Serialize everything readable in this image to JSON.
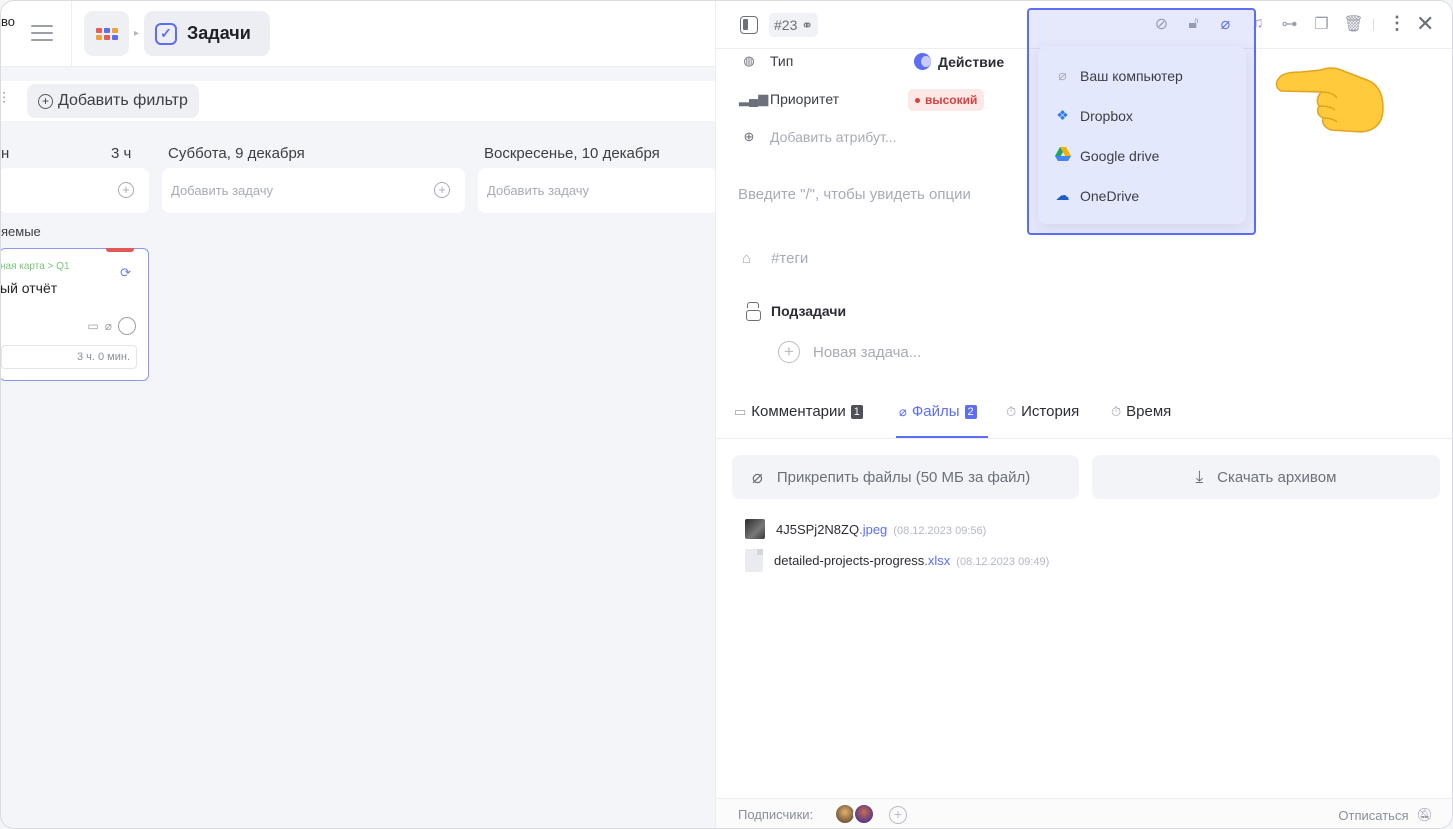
{
  "topbar": {
    "fragment_text": "во",
    "section_title": "Задачи"
  },
  "filter": {
    "add_label": "Добавить фильтр"
  },
  "columns": [
    {
      "title": "н",
      "hours": "3 ч",
      "add_placeholder": ""
    },
    {
      "title": "Суббота, 9 декабря",
      "hours": "",
      "add_placeholder": "Добавить задачу"
    },
    {
      "title": "Воскресенье, 10 декабря",
      "hours": "",
      "add_placeholder": "Добавить задачу"
    }
  ],
  "section_label": "яемые",
  "card": {
    "path": "ная карта > Q1",
    "title": "ый отчёт",
    "time": "3 ч. 0 мин."
  },
  "task": {
    "id": "#23",
    "attributes": {
      "type_label": "Тип",
      "type_value": "Действие",
      "priority_label": "Приоритет",
      "priority_value": "высокий",
      "add_attribute": "Добавить атрибут..."
    },
    "editor_placeholder": "Введите \"/\", чтобы увидеть опции",
    "tags_placeholder": "#теги",
    "subtasks_title": "Подзадачи",
    "new_subtask": "Новая задача...",
    "tabs": [
      {
        "label": "Комментарии",
        "count": "1"
      },
      {
        "label": "Файлы",
        "count": "2"
      },
      {
        "label": "История",
        "count": ""
      },
      {
        "label": "Время",
        "count": ""
      }
    ],
    "active_tab": "Файлы",
    "attach_button": "Прикрепить файлы (50 МБ за файл)",
    "archive_button": "Скачать архивом",
    "files": [
      {
        "name": "4J5SPj2N8ZQ",
        "ext": ".jpeg",
        "date": "(08.12.2023 09:56)"
      },
      {
        "name": "detailed-projects-progress",
        "ext": ".xlsx",
        "date": "(08.12.2023 09:49)"
      }
    ],
    "subscribers_label": "Подписчики:",
    "unsubscribe": "Отписаться"
  },
  "attach_menu": {
    "items": [
      {
        "label": "Ваш компьютер",
        "icon": "paperclip-icon"
      },
      {
        "label": "Dropbox",
        "icon": "dropbox-icon"
      },
      {
        "label": "Google drive",
        "icon": "google-drive-icon"
      },
      {
        "label": "OneDrive",
        "icon": "onedrive-icon"
      }
    ]
  },
  "colors": {
    "accent": "#5b6ef5",
    "priority": "#d9413f"
  }
}
